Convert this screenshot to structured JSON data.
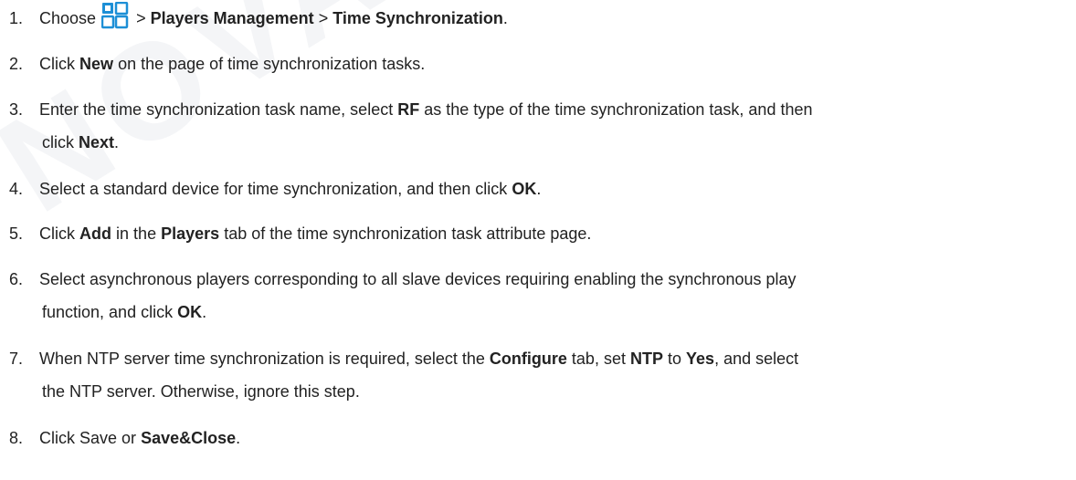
{
  "watermark": "NOVASTAR",
  "accent_color": "#1d8fd6",
  "step1": {
    "num": "1.",
    "pre": "Choose",
    "icon": "grid-menu-icon",
    "sep1": ">",
    "b1": "Players Management",
    "sep2": ">",
    "b2": "Time Synchronization",
    "end": "."
  },
  "step2": {
    "num": "2.",
    "t1": "Click",
    "b1": "New",
    "t2": "on the page of time synchronization tasks."
  },
  "step3": {
    "num": "3.",
    "t1": "Enter the time synchronization task name, select",
    "b1": "RF",
    "t2": "as the type of the time synchronization task, and then",
    "t3": "click",
    "b2": "Next",
    "t4": "."
  },
  "step4": {
    "num": "4.",
    "t1": "Select a standard device for time synchronization, and then click",
    "b1": "OK",
    "t2": "."
  },
  "step5": {
    "num": "5.",
    "t1": "Click",
    "b1": "Add",
    "t2": "in the",
    "b2": "Players",
    "t3": "tab of the time synchronization task attribute page."
  },
  "step6": {
    "num": "6.",
    "t1": "Select asynchronous players corresponding to all slave devices requiring enabling the synchronous play",
    "t2": "function, and click",
    "b1": "OK",
    "t3": "."
  },
  "step7": {
    "num": "7.",
    "t1": "When NTP server time synchronization is required, select the",
    "b1": "Configure",
    "t2": "tab, set",
    "b2": "NTP",
    "t3": "to",
    "b3": "Yes",
    "t4": ", and select",
    "t5": "the NTP server. Otherwise, ignore this step."
  },
  "step8": {
    "num": "8.",
    "t1": "Click Save or",
    "b1": "Save&Close",
    "t2": "."
  }
}
